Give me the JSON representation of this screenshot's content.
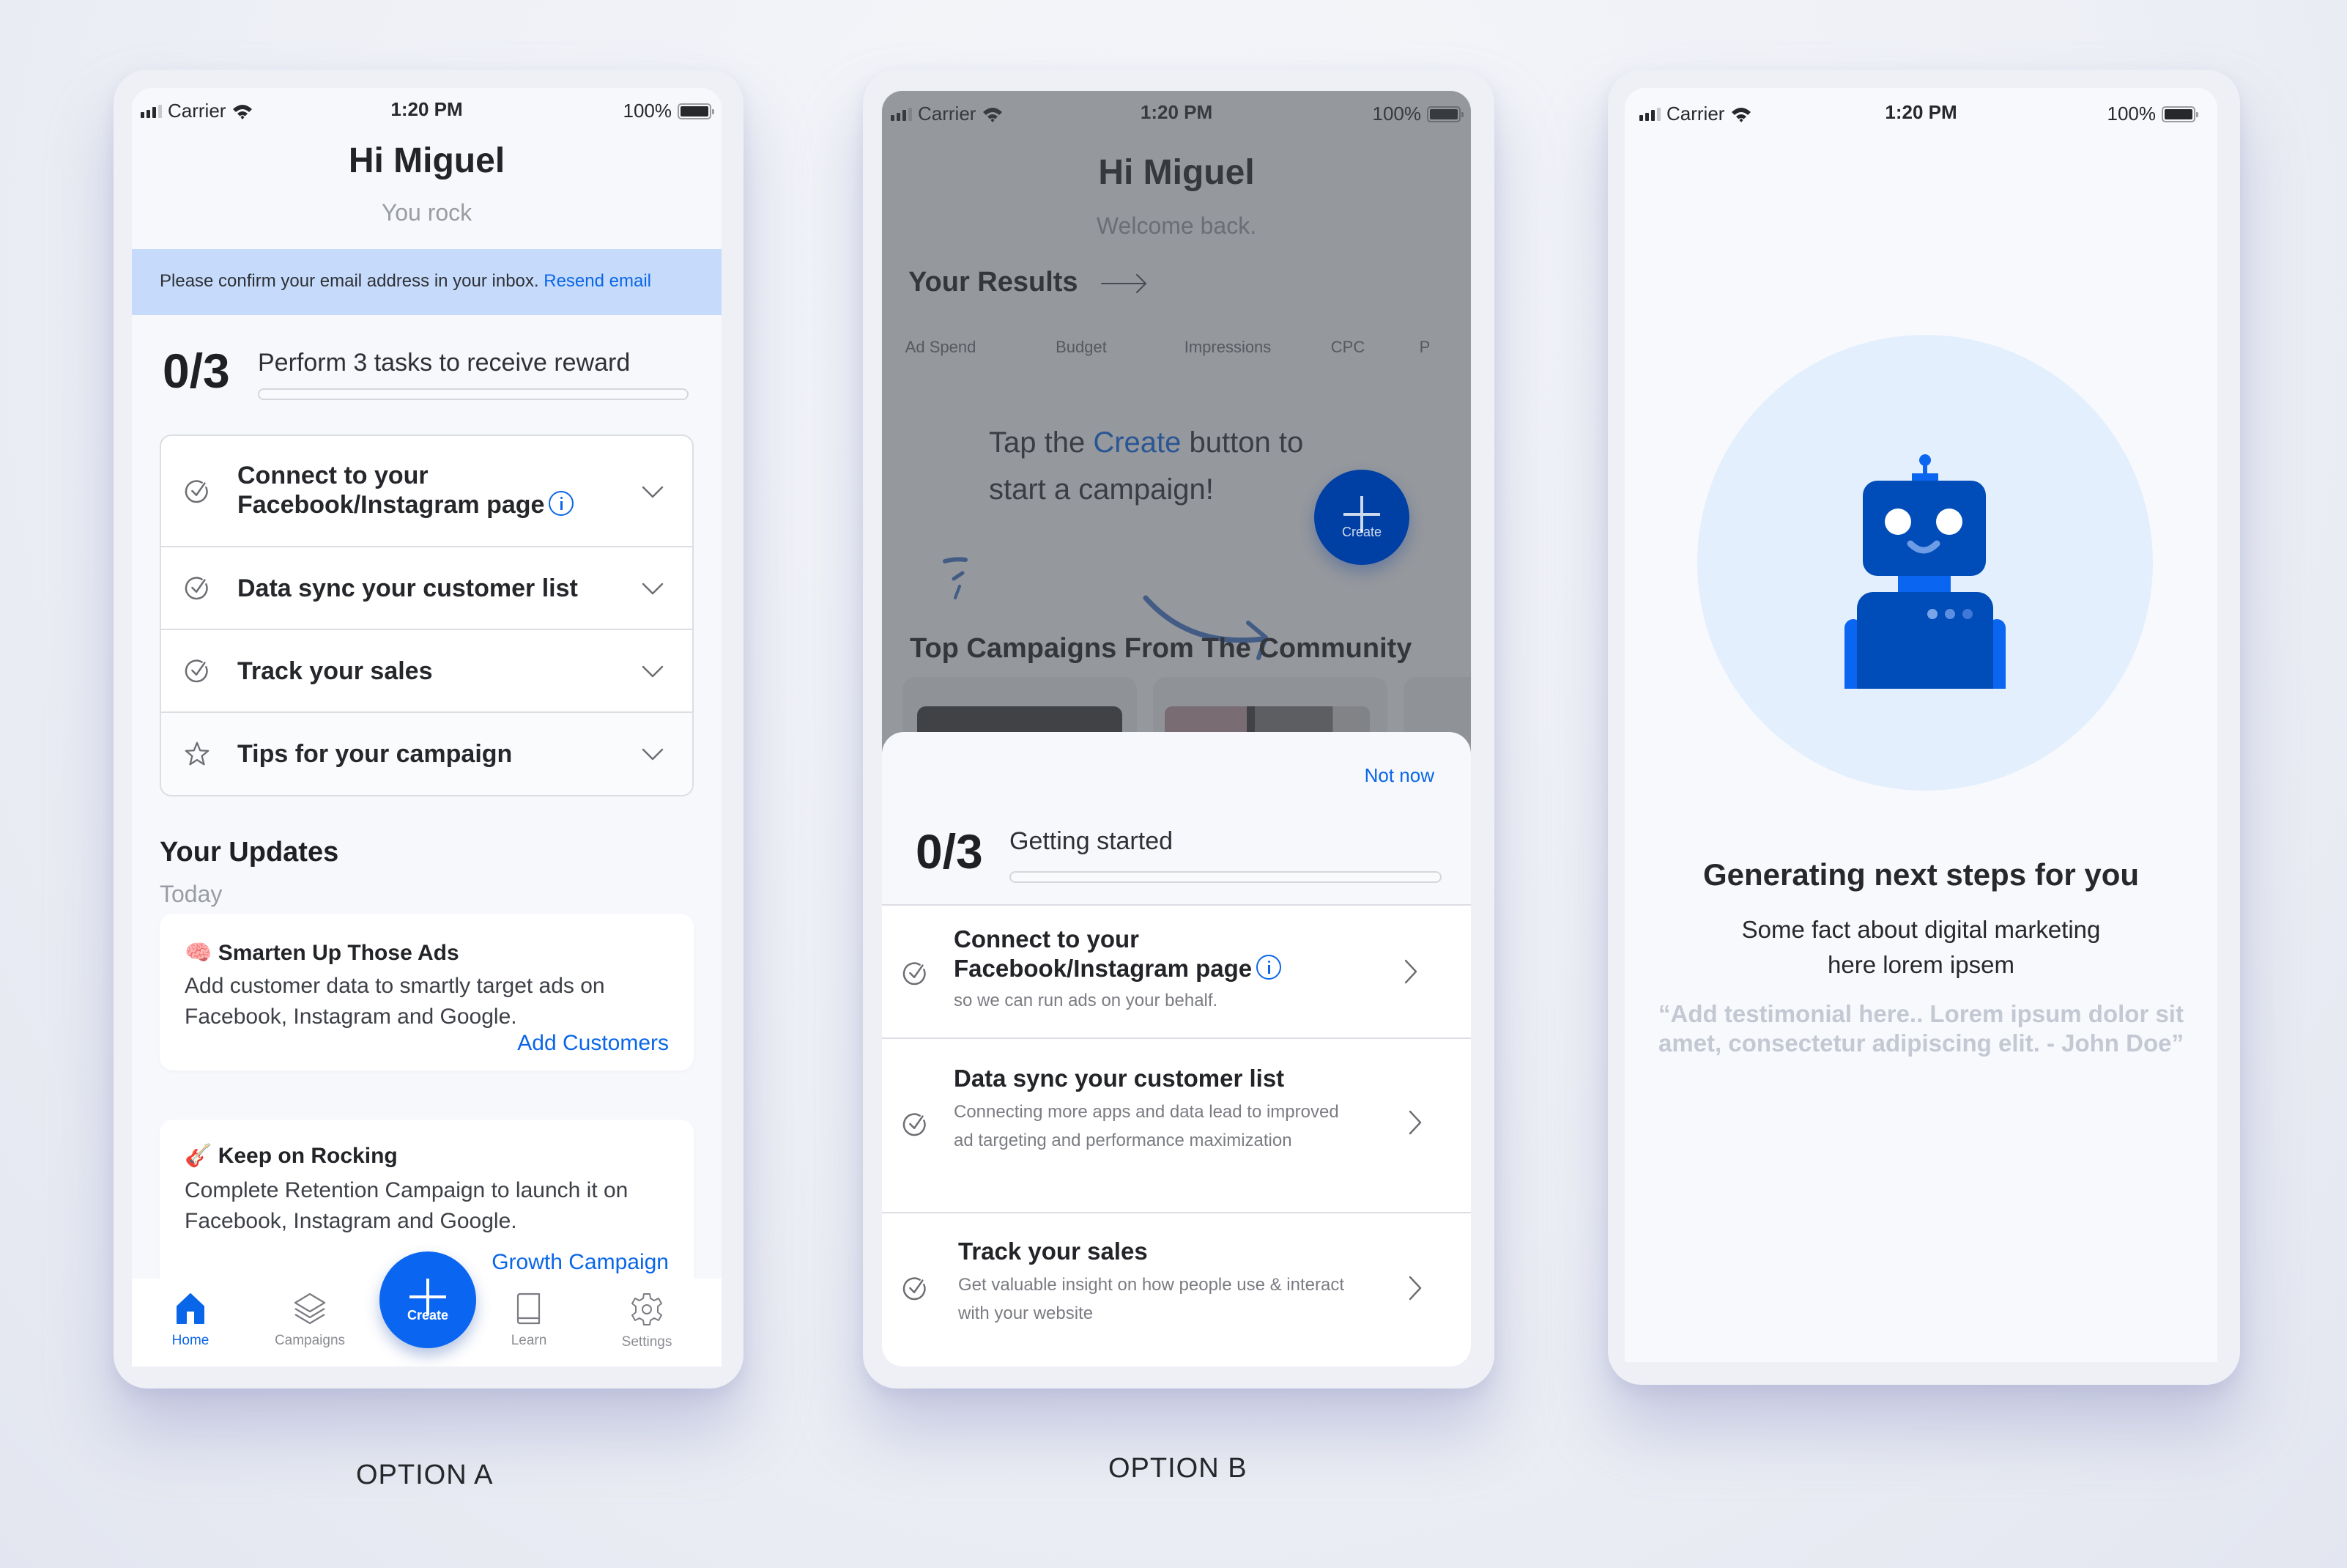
{
  "status_bar": {
    "carrier": "Carrier",
    "time": "1:20 PM",
    "battery": "100%"
  },
  "colors": {
    "accent": "#0a66e8",
    "banner_bg": "#c6dbfb",
    "robot_dark": "#004cb8",
    "robot_light": "#0a66f0",
    "robot_bg": "#e3effd"
  },
  "option_a": {
    "label": "OPTION A",
    "greeting": "Hi Miguel",
    "subtitle": "You rock",
    "banner": {
      "text": "Please confirm your email address in your inbox.",
      "link": "Resend email"
    },
    "progress": {
      "count": "0/3",
      "label": "Perform 3 tasks to receive reward",
      "fraction": 0
    },
    "tasks": [
      {
        "icon": "check-circle-icon",
        "line1": "Connect to your",
        "line2": "Facebook/Instagram page",
        "has_info": true
      },
      {
        "icon": "check-circle-icon",
        "line1": "Data sync your customer list"
      },
      {
        "icon": "check-circle-icon",
        "line1": "Track your sales"
      },
      {
        "icon": "star-icon",
        "line1": "Tips for your campaign"
      }
    ],
    "updates": {
      "heading": "Your Updates",
      "date": "Today",
      "cards": [
        {
          "emoji": "🧠",
          "title": "Smarten Up Those Ads",
          "body": "Add customer data to smartly target ads on Facebook, Instagram and Google.",
          "action": "Add Customers"
        },
        {
          "emoji": "🎸",
          "title": "Keep on Rocking",
          "body": "Complete Retention Campaign to launch it on Facebook, Instagram and Google.",
          "action": "Growth Campaign"
        }
      ]
    },
    "tabs": [
      {
        "label": "Home",
        "icon": "home-icon",
        "active": true
      },
      {
        "label": "Campaigns",
        "icon": "layers-icon"
      },
      {
        "label": "Learn",
        "icon": "book-icon"
      },
      {
        "label": "Settings",
        "icon": "gear-icon"
      }
    ],
    "fab_label": "Create"
  },
  "option_b": {
    "label": "OPTION B",
    "greeting": "Hi Miguel",
    "subtitle": "Welcome back.",
    "results_heading": "Your Results",
    "chips": [
      "Ad Spend",
      "Budget",
      "Impressions",
      "CPC",
      "P"
    ],
    "hint": {
      "pre": "Tap the ",
      "highlight": "Create",
      "post": " button to",
      "line2": "start a campaign!"
    },
    "fab_label": "Create",
    "community_heading": "Top Campaigns From The Community",
    "sheet": {
      "dismiss": "Not now",
      "count": "0/3",
      "label": "Getting started",
      "fraction": 0,
      "tasks": [
        {
          "line1": "Connect to your",
          "line2": "Facebook/Instagram page",
          "has_info": true,
          "desc": "so we can run ads on your behalf."
        },
        {
          "line1": "Data sync your customer list",
          "desc": "Connecting more apps and data lead to improved ad targeting and performance maximization"
        },
        {
          "line1": "Track your sales",
          "desc": "Get valuable insight on how people use & interact with your website"
        }
      ]
    }
  },
  "option_c": {
    "heading": "Generating next steps for you",
    "fact": "Some fact about digital marketing here lorem ipsem",
    "testimonial": "“Add testimonial here.. Lorem ipsum dolor sit amet, consectetur adipiscing elit. - John Doe”"
  }
}
